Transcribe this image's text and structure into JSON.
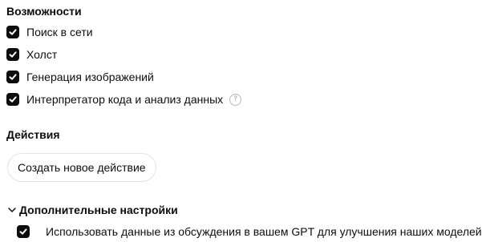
{
  "capabilities": {
    "title": "Возможности",
    "items": [
      {
        "label": "Поиск в сети",
        "checked": true
      },
      {
        "label": "Холст",
        "checked": true
      },
      {
        "label": "Генерация изображений",
        "checked": true
      },
      {
        "label": "Интерпретатор кода и анализ данных",
        "checked": true,
        "help_icon": "?"
      }
    ]
  },
  "actions": {
    "title": "Действия",
    "create_button_label": "Создать новое действие"
  },
  "advanced": {
    "title": "Дополнительные настройки",
    "expanded": true,
    "items": [
      {
        "label": "Использовать данные из обсуждения в вашем GPT для улучшения наших моделей",
        "checked": true
      }
    ]
  },
  "icons": {
    "checkbox": "check-icon",
    "help": "question-circle-icon",
    "toggle": "chevron-down-icon"
  },
  "colors": {
    "checkbox_fill": "#0d0d0d",
    "text": "#0d0d0d",
    "button_border": "#e3e3e3",
    "help_icon": "#9b9b9b"
  }
}
